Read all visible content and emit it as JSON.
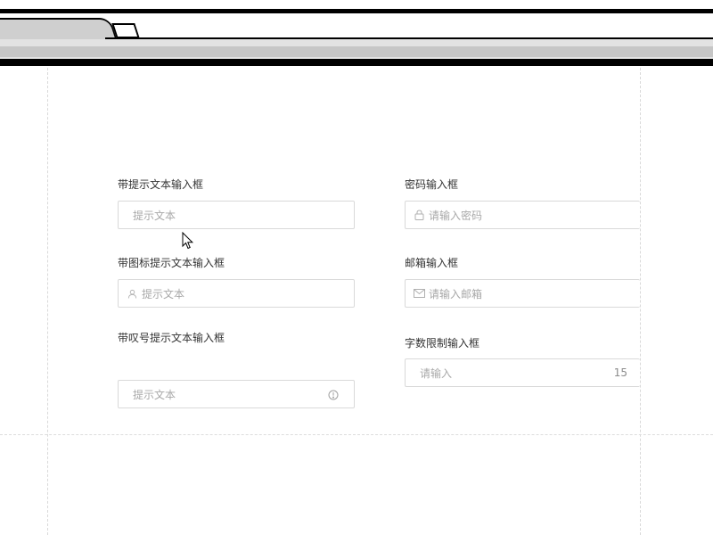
{
  "form": {
    "left": [
      {
        "label": "带提示文本输入框",
        "placeholder": "提示文本"
      },
      {
        "label": "带图标提示文本输入框",
        "placeholder": "提示文本",
        "icon": "user-icon"
      },
      {
        "label": "带叹号提示文本输入框",
        "placeholder": "提示文本",
        "icon": "info-circle-icon"
      }
    ],
    "right": [
      {
        "label": "密码输入框",
        "placeholder": "请输入密码",
        "icon": "lock-icon"
      },
      {
        "label": "邮箱输入框",
        "placeholder": "请输入邮箱",
        "icon": "mail-icon"
      },
      {
        "label": "字数限制输入框",
        "placeholder": "请输入",
        "count": "15"
      }
    ]
  },
  "colors": {
    "border": "#d9d9d9",
    "placeholder": "#a8a8a8",
    "label": "#333333"
  }
}
